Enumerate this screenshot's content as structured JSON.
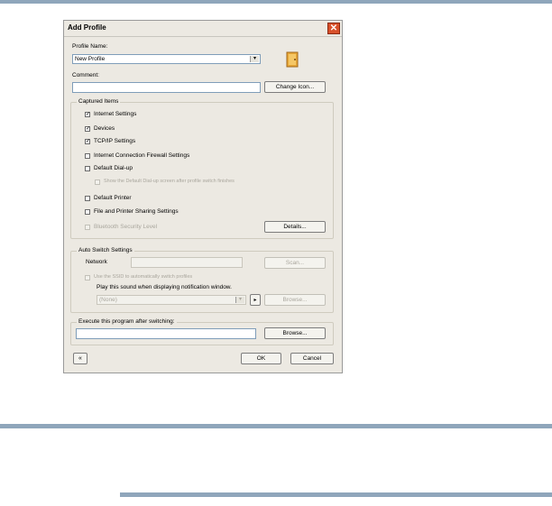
{
  "dialog": {
    "title": "Add Profile",
    "close_icon": "close-icon",
    "profile_name_label": "Profile Name:",
    "profile_name_value": "New Profile",
    "comment_label": "Comment:",
    "comment_value": "",
    "change_icon_button": "Change Icon...",
    "profile_icon": "folder-door-icon",
    "captured_items": {
      "label": "Captured Items",
      "items": [
        {
          "label": "Internet Settings",
          "checked": true,
          "enabled": true
        },
        {
          "label": "Devices",
          "checked": true,
          "enabled": true
        },
        {
          "label": "TCP/IP Settings",
          "checked": true,
          "enabled": true
        },
        {
          "label": "Internet Connection Firewall Settings",
          "checked": false,
          "enabled": true
        },
        {
          "label": "Default Dial-up",
          "checked": false,
          "enabled": true
        },
        {
          "label": "Show the Default Dial-up screen after profile switch finishes",
          "checked": false,
          "enabled": false
        },
        {
          "label": "Default Printer",
          "checked": false,
          "enabled": true
        },
        {
          "label": "File and Printer Sharing Settings",
          "checked": false,
          "enabled": true
        },
        {
          "label": "Bluetooth Security Level",
          "checked": false,
          "enabled": false
        }
      ],
      "details_button": "Details..."
    },
    "auto_switch": {
      "label": "Auto Switch Settings",
      "network_label": "Network",
      "network_value": "",
      "scan_button": "Scan...",
      "ssid_checkbox": "Use the SSID to automatically switch profiles",
      "sound_label": "Play this sound when displaying notification window.",
      "sound_value": "(None)",
      "play_icon": "play-icon",
      "browse_button": "Browse..."
    },
    "execute": {
      "label": "Execute this program after switching:",
      "value": "",
      "browse_button": "Browse..."
    },
    "collapse_icon": "double-chevron-up-icon",
    "ok_button": "OK",
    "cancel_button": "Cancel"
  }
}
